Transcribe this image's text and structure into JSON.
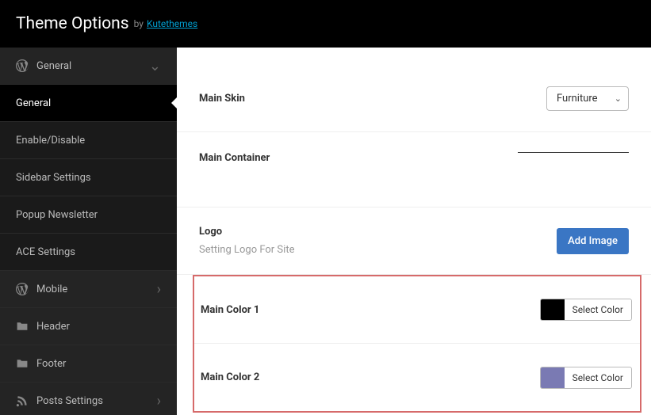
{
  "header": {
    "title": "Theme Options",
    "by": "by",
    "link": "Kutethemes"
  },
  "sidebar": {
    "general_section": "General",
    "items": {
      "general": "General",
      "enable": "Enable/Disable",
      "sidebar": "Sidebar Settings",
      "popup": "Popup Newsletter",
      "ace": "ACE Settings"
    },
    "mobile": "Mobile",
    "header_section": "Header",
    "footer": "Footer",
    "posts": "Posts Settings"
  },
  "content": {
    "skin": {
      "label": "Main Skin",
      "value": "Furniture"
    },
    "container": {
      "label": "Main Container"
    },
    "logo": {
      "label": "Logo",
      "desc": "Setting Logo For Site",
      "button": "Add Image"
    },
    "color1": {
      "label": "Main Color 1",
      "button": "Select Color"
    },
    "color2": {
      "label": "Main Color 2",
      "button": "Select Color"
    }
  }
}
